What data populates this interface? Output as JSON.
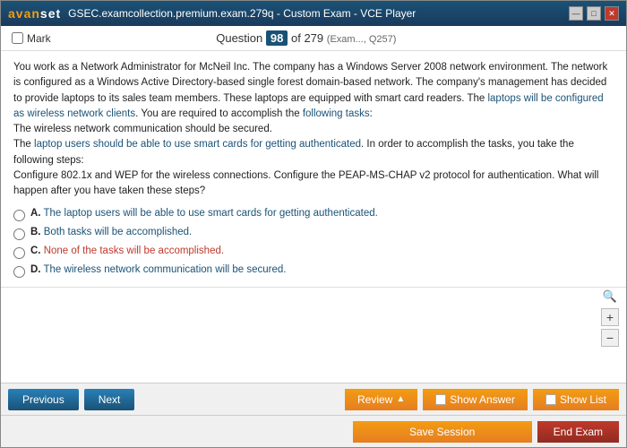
{
  "titleBar": {
    "logo": "avan",
    "logoAccent": "set",
    "title": "GSEC.examcollection.premium.exam.279q - Custom Exam - VCE Player",
    "controls": [
      "—",
      "□",
      "✕"
    ]
  },
  "questionHeader": {
    "markLabel": "Mark",
    "questionLabel": "Question",
    "questionNumber": "98",
    "totalQuestions": "of 279",
    "subInfo": "(Exam..., Q257)"
  },
  "questionText": {
    "paragraph1": "You work as a Network Administrator for McNeil Inc. The company has a Windows Server 2008 network environment. The network is configured as a Windows Active Directory-based single forest domain-based network. The company's management has decided to provide laptops to its sales team members. These laptops are equipped with smart card readers. The laptops will be configured as wireless network clients. You are required to accomplish the following tasks:",
    "line1": "The wireless network communication should be secured.",
    "paragraph2": "The laptop users should be able to use smart cards for getting authenticated. In order to accomplish the tasks, you take the following steps:",
    "line2": "Configure 802.1x and WEP for the wireless connections. Configure the PEAP-MS-CHAP v2 protocol for authentication. What will happen after you have taken these steps?"
  },
  "options": [
    {
      "label": "A.",
      "text": "The laptop users will be able to use smart cards for getting authenticated."
    },
    {
      "label": "B.",
      "text": "Both tasks will be accomplished."
    },
    {
      "label": "C.",
      "text": "None of the tasks will be accomplished."
    },
    {
      "label": "D.",
      "text": "The wireless network communication will be secured."
    }
  ],
  "buttons": {
    "previous": "Previous",
    "next": "Next",
    "review": "Review",
    "showAnswer": "Show Answer",
    "showList": "Show List",
    "saveSession": "Save Session",
    "endExam": "End Exam"
  },
  "zoom": {
    "plus": "+",
    "minus": "−",
    "searchIcon": "🔍"
  }
}
